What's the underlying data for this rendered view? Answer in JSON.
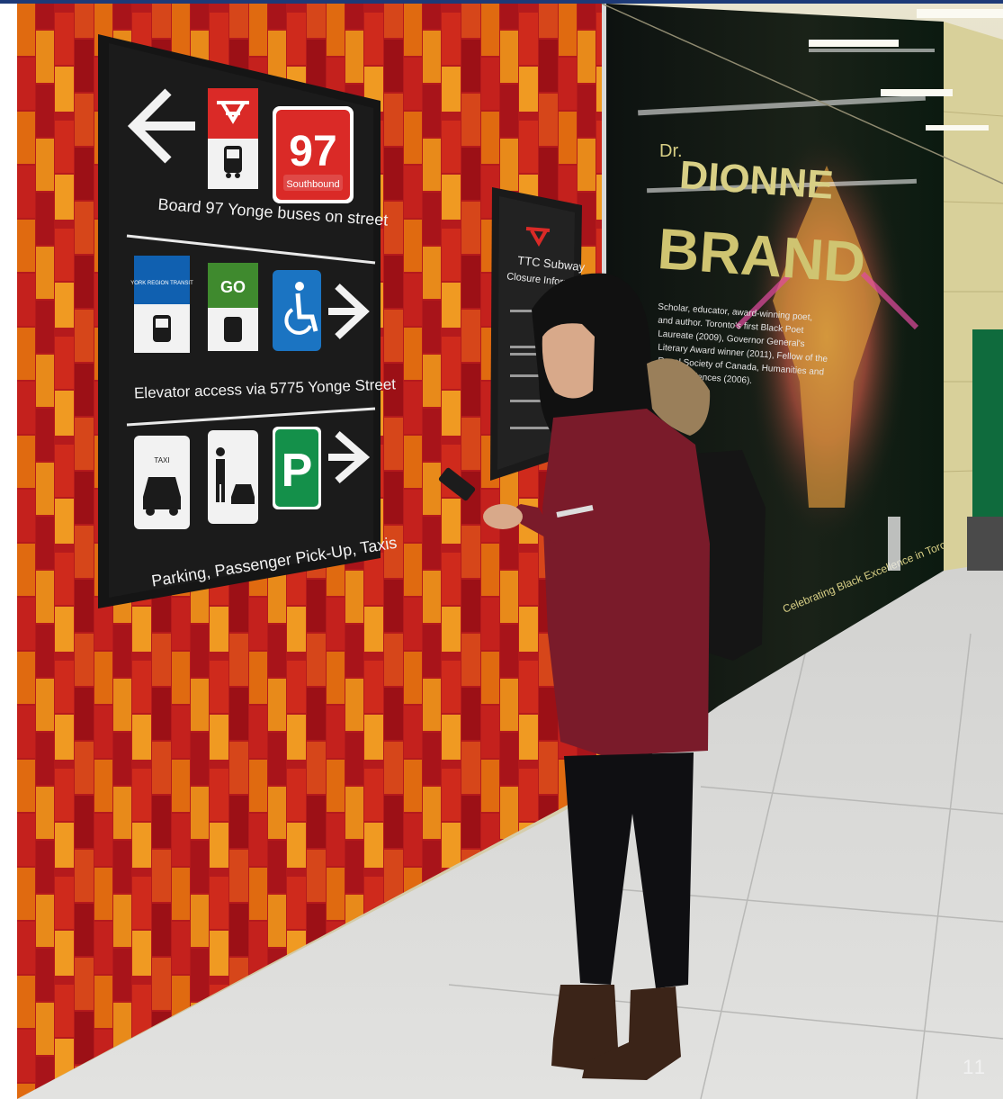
{
  "page": {
    "number": "11"
  },
  "wayfinding_sign": {
    "route_number": "97",
    "route_direction": "Southbound",
    "row1_caption": "Board 97 Yonge buses on street",
    "yrt_label": "YORK REGION TRANSIT",
    "go_label": "GO",
    "row2_caption": "Elevator access via 5775 Yonge Street",
    "parking_label": "P",
    "row3_caption": "Parking, Passenger Pick-Up, Taxis",
    "taxi_roof_label": "TAXI"
  },
  "closure_sign": {
    "title_line1": "TTC Subway",
    "title_line2": "Closure Information"
  },
  "mural": {
    "title_line1": "DIONNE",
    "title_line2": "BRAND",
    "prefix": "Dr.",
    "bio_lines": [
      "Scholar, educator, award-winning poet,",
      "and author. Toronto's first Black Poet",
      "Laureate (2009), Governor General's",
      "Literary Award winner (2011), Fellow of the",
      "Royal Society of Canada, Humanities and",
      "Social Sciences (2006)."
    ],
    "footer": "Celebrating Black Excellence in Toronto"
  },
  "colors": {
    "brand_bar": "#1d3a78",
    "ttc_red": "#da2a27",
    "yrt_blue": "#1060b0",
    "go_green": "#3f8a2e",
    "access_blue": "#1b74c2",
    "parking_green": "#14904a",
    "sign_black": "#1b1b1b"
  },
  "icons": [
    "arrow-left-icon",
    "ttc-logo-icon",
    "bus-icon",
    "wheelchair-icon",
    "arrow-right-icon",
    "taxi-icon",
    "passenger-pickup-icon",
    "parking-icon"
  ]
}
